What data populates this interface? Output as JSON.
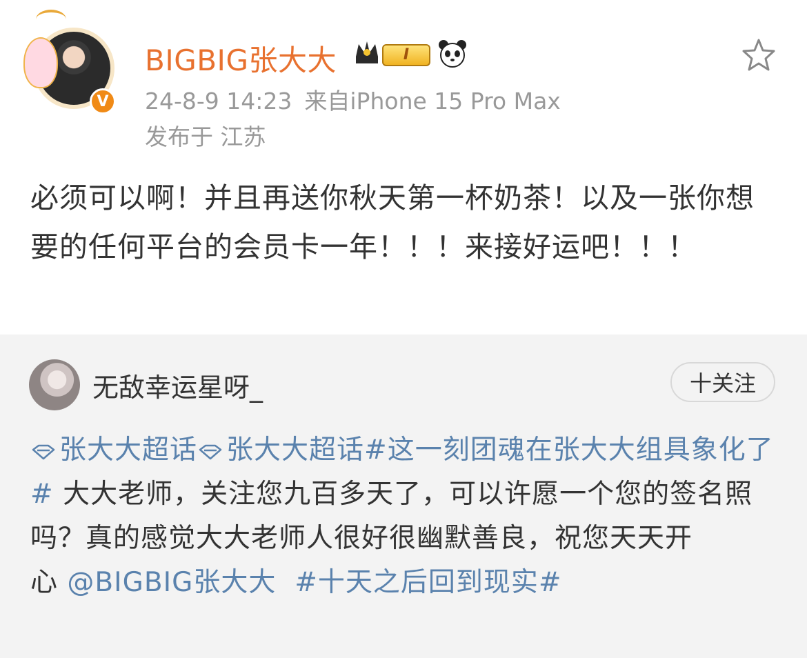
{
  "post": {
    "author_name": "BIGBIG张大大",
    "level_label": "I",
    "timestamp": "24-8-9 14:23",
    "source": "来自iPhone 15 Pro Max",
    "location": "发布于 江苏",
    "text": "必须可以啊！并且再送你秋天第一杯奶茶！以及一张你想要的任何平台的会员卡一年！！！来接好运吧！！！",
    "icons": [
      "avatar",
      "verified-badge",
      "crown-icon",
      "level-badge",
      "panda-icon",
      "star-icon"
    ]
  },
  "retweet": {
    "author_name": "无敌幸运星呀_",
    "follow_label": "十关注",
    "topic1": "张大大超话",
    "topic2": "张大大超话",
    "hashtag1": "#这一刻团魂在张大大组具象化了#",
    "body": " 大大老师，关注您九百多天了，可以许愿一个您的签名照吗？真的感觉大大老师人很好很幽默善良，祝您天天开心",
    "mention": "@BIGBIG张大大",
    "hashtag2": "#十天之后回到现实#"
  },
  "colors": {
    "username_orange": "#e8712f",
    "meta_gray": "#999999",
    "link_blue": "#5a82ad",
    "retweet_bg": "#f3f3f3"
  }
}
